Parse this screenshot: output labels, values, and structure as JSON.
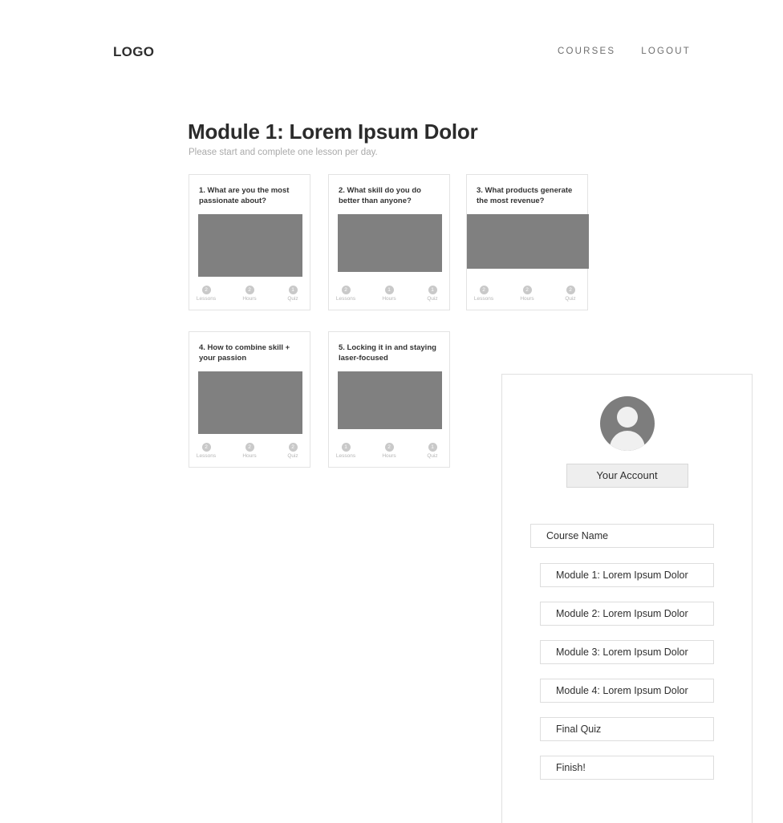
{
  "header": {
    "logo": "LOGO",
    "nav": [
      {
        "label": "COURSES",
        "name": "courses"
      },
      {
        "label": "LOGOUT",
        "name": "logout"
      }
    ]
  },
  "main": {
    "title": "Module 1: Lorem Ipsum Dolor",
    "subtitle": "Please start and complete one lesson per day.",
    "stat_labels": {
      "lessons": "Lessons",
      "hours": "Hours",
      "quiz": "Quiz"
    },
    "cards": [
      {
        "title": "1. What are you the most passionate about?",
        "lessons": "2",
        "hours": "2",
        "quiz": "1"
      },
      {
        "title": "2. What skill do you do better than anyone?",
        "lessons": "2",
        "hours": "1",
        "quiz": "1"
      },
      {
        "title": "3. What products generate the most revenue?",
        "lessons": "2",
        "hours": "2",
        "quiz": "2"
      },
      {
        "title": "4. How to combine skill + your passion",
        "lessons": "2",
        "hours": "2",
        "quiz": "2"
      },
      {
        "title": "5. Locking it in and staying laser-focused",
        "lessons": "1",
        "hours": "2",
        "quiz": "1"
      }
    ]
  },
  "panel": {
    "account_button": "Your Account",
    "course_name": "Course Name",
    "modules": [
      "Module 1: Lorem Ipsum Dolor",
      "Module 2: Lorem Ipsum Dolor",
      "Module 3: Lorem Ipsum Dolor",
      "Module 4: Lorem Ipsum Dolor",
      "Final Quiz",
      "Finish!"
    ]
  },
  "colors": {
    "background": "#ffffff",
    "text": "#2b2b2b",
    "muted": "#aaaaaa",
    "placeholder": "#808080",
    "border": "#e3e3e3",
    "button": "#eeeeee"
  }
}
